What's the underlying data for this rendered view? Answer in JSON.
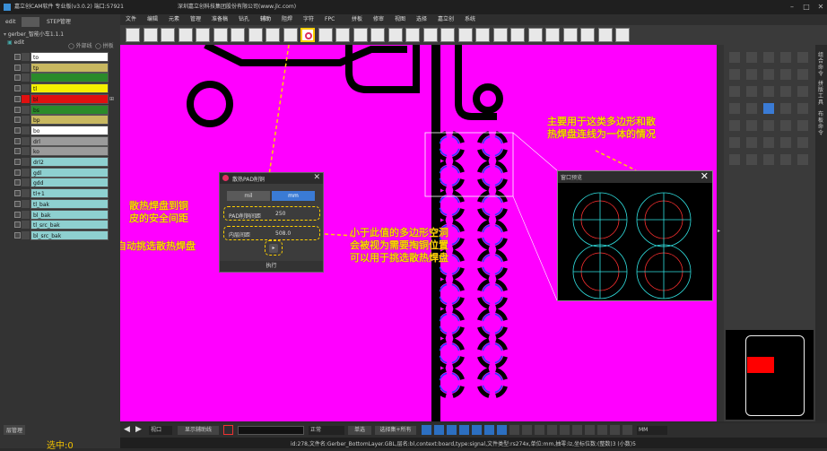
{
  "titlebar": {
    "title": "嘉立创CAM软件 专业版(v3.0.2) 端口:57921",
    "company": "深圳嘉立创科技集团股份有限公司(www.jlc.com)"
  },
  "left_panel": {
    "tabs": [
      "edit",
      "STEP管理"
    ],
    "tree_root": "gerber_智能小车1.1.1",
    "tree_edit": "edit",
    "opt_outline": "外部线",
    "opt_board": "拼板",
    "layers": [
      {
        "name": "to",
        "color": "#ffffff"
      },
      {
        "name": "tp",
        "color": "#c8b860"
      },
      {
        "name": "",
        "color": "#2a8a2a"
      },
      {
        "name": "tl",
        "color": "#f5f000"
      },
      {
        "name": "bl",
        "color": "#e01010"
      },
      {
        "name": "bs",
        "color": "#2a8a2a"
      },
      {
        "name": "bp",
        "color": "#c8b860"
      },
      {
        "name": "bo",
        "color": "#ffffff"
      },
      {
        "name": "drl",
        "color": "#9b9b9b"
      },
      {
        "name": "ko",
        "color": "#9b9b9b"
      },
      {
        "name": "drl2",
        "color": "#8ed0d0"
      },
      {
        "name": "gdl",
        "color": "#8ed0d0"
      },
      {
        "name": "gdd",
        "color": "#8ed0d0"
      },
      {
        "name": "tl+1",
        "color": "#8ed0d0"
      },
      {
        "name": "tl_bak",
        "color": "#8ed0d0"
      },
      {
        "name": "bl_bak",
        "color": "#8ed0d0"
      },
      {
        "name": "tl_src_bak",
        "color": "#8ed0d0"
      },
      {
        "name": "bl_src_bak",
        "color": "#8ed0d0"
      }
    ],
    "bottom_tab": "层管理",
    "selected": "选中:0"
  },
  "menubar": [
    "文件",
    "编辑",
    "元素",
    "管理",
    "准备稿",
    "钻孔",
    "辅助",
    "阻焊",
    "字符",
    "FPC",
    "拼板",
    "修审",
    "视图",
    "选择",
    "嘉立创",
    "系统"
  ],
  "dialog": {
    "title": "散热PAD削铜",
    "tab_mil": "mil",
    "tab_mm": "mm",
    "clearance_label": "PAD削铜间距",
    "clearance_value": "250",
    "min_label": "内层间距",
    "min_value": "508.0",
    "exec_label": "执行"
  },
  "callouts": {
    "clearance": "散热焊盘到铜\n皮的安全间距",
    "auto": "自动挑选散热焊盘",
    "threshold": "小于此值的多边形空洞\n会被视为需要掏铜位置\n可以用于挑选散热焊盘",
    "top": "主要用于这类多边形和散\n热焊盘连线为一体的情况"
  },
  "preview": {
    "title": "窗口预览"
  },
  "bottom_toolbar": {
    "dropdown1": "视口",
    "button_label": "显示辅助线",
    "mode": "正常",
    "btn_single": "单选",
    "btn_all": "选择集+所有",
    "unit": "MM"
  },
  "status": "id:278,文件名:Gerber_BottomLayer.GBL,层名:bl,context:board,type:signal,文件类型:rs274x,单位:mm,抽零:lz,坐标位数:(整数)3 (小数)5",
  "right_panel": {
    "vert_labels": [
      "组合命令",
      "拼版工具",
      "布板命令"
    ]
  }
}
